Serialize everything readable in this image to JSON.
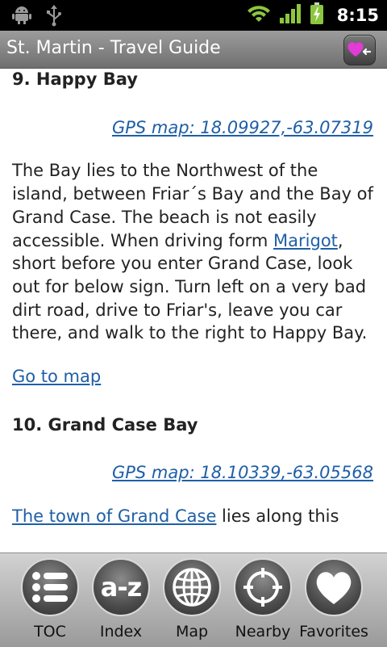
{
  "status_bar": {
    "time": "8:15",
    "icons": [
      "android-debug-icon",
      "usb-icon",
      "wifi-icon",
      "signal-icon",
      "battery-charging-icon"
    ]
  },
  "app": {
    "title": "St. Martin - Travel Guide"
  },
  "content": {
    "section1": {
      "heading": "9. Happy Bay",
      "gps_link": "GPS map: 18.09927,-63.07319",
      "para_before_link": "The Bay lies to the Northwest of the island, between Friar´s Bay and the Bay of Grand Case. The beach is not easily accessible. When driving form ",
      "link_marigot": "Marigot",
      "para_after_link": ", short before you enter Grand Case, look out for below sign. Turn left on a very bad dirt road, drive to Friar's, leave you car there, and walk to the right to Happy Bay.",
      "go_to_map": "Go to map"
    },
    "section2": {
      "heading": "10. Grand Case Bay",
      "gps_link": "GPS map: 18.10339,-63.05568",
      "link_town": "The town of Grand Case",
      "para_after_link": " lies along this"
    }
  },
  "bottom_nav": {
    "items": [
      {
        "label": "TOC",
        "icon": "list-icon"
      },
      {
        "label": "Index",
        "icon": "a-z-icon"
      },
      {
        "label": "Map",
        "icon": "globe-icon"
      },
      {
        "label": "Nearby",
        "icon": "crosshair-icon"
      },
      {
        "label": "Favorites",
        "icon": "heart-icon"
      }
    ],
    "index_icon_text": "a-z"
  },
  "colors": {
    "link": "#1f5fa6",
    "title_bar": "#8a8a8a",
    "status_icons": "#8cc63f"
  }
}
